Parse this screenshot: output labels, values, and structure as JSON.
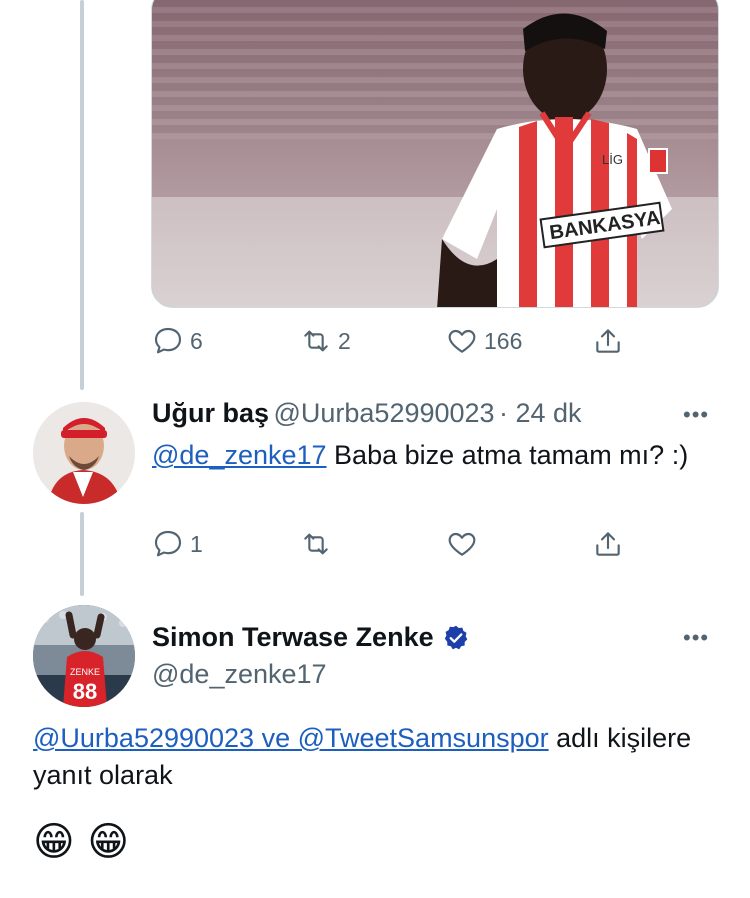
{
  "tweet1": {
    "media": {
      "shirt_text_1": "LİG",
      "shirt_text_2": "BANKASYA"
    },
    "actions": {
      "replies": "6",
      "retweets": "2",
      "likes": "166"
    }
  },
  "reply1": {
    "name": "Uğur baş",
    "handle": "@Uurba52990023",
    "time": "· 24 dk",
    "mention": "@de_zenke17",
    "text": " Baba bize atma tamam mı? :)",
    "actions": {
      "replies": "1",
      "retweets": "",
      "likes": ""
    }
  },
  "reply2": {
    "name": "Simon Terwase Zenke",
    "handle": "@de_zenke17",
    "reply_to_1": "@Uurba52990023 ve @TweetSamsunspor",
    "reply_to_rest": " adlı kişilere yanıt olarak",
    "emojis": "😁 😁",
    "jersey_name": "ZENKE",
    "jersey_number": "88"
  },
  "more_icon": "•••",
  "colors": {
    "link": "#1d5fbf",
    "muted": "#536471",
    "verified": "#1d3fa8",
    "thread_line": "#c4cfd6"
  }
}
